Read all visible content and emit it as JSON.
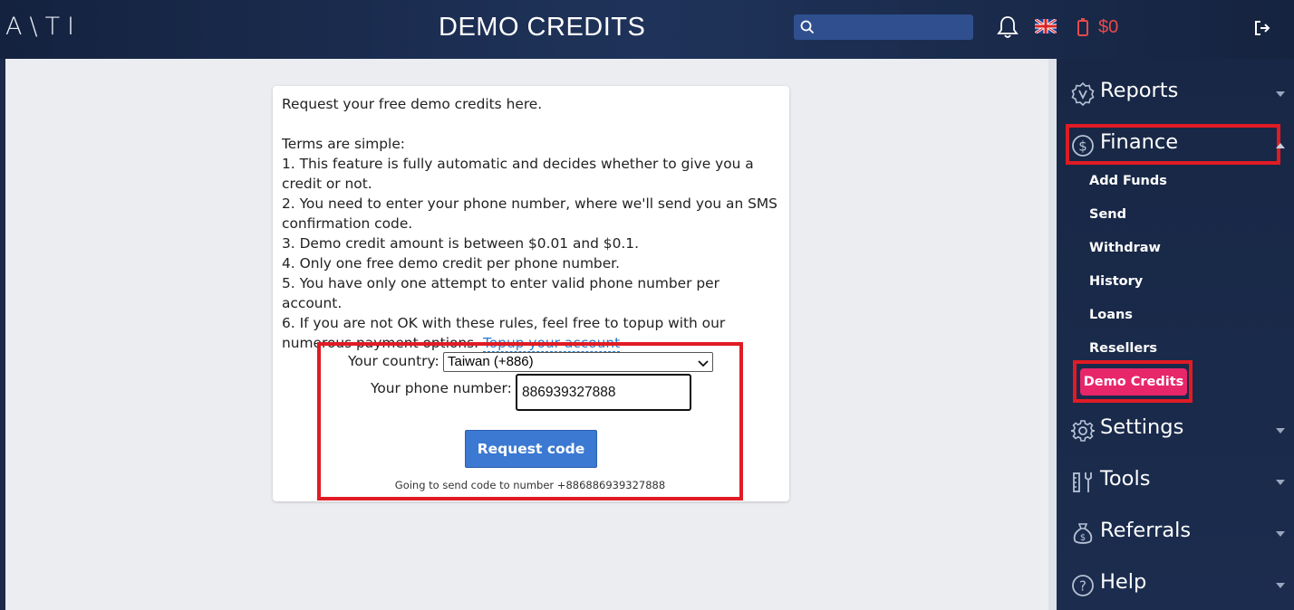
{
  "app": {
    "logo_text": "A\\TI",
    "page_title": "DEMO CREDITS",
    "balance": "$0",
    "search_placeholder": ""
  },
  "card": {
    "intro": "Request your free demo credits here.",
    "terms_heading": "Terms are simple:",
    "terms": [
      "1. This feature is fully automatic and decides whether to give you a credit or not.",
      "2. You need to enter your phone number, where we'll send you an SMS confirmation code.",
      "3. Demo credit amount is between $0.01 and $0.1.",
      "4. Only one free demo credit per phone number.",
      "5. You have only one attempt to enter valid phone number per account.",
      "6. If you are not OK with these rules, feel free to topup with our numerous payment options."
    ],
    "topup_link": "Topup your account"
  },
  "form": {
    "country_label": "Your country:",
    "country_value": "Taiwan (+886)",
    "phone_label": "Your phone number:",
    "phone_value": "886939327888",
    "request_button": "Request code",
    "hint": "Going to send code to number +886886939327888"
  },
  "sidebar": {
    "items": [
      {
        "label": "Reports",
        "icon": "badge-icon",
        "expanded": false
      },
      {
        "label": "Finance",
        "icon": "dollar-icon",
        "expanded": true
      },
      {
        "label": "Settings",
        "icon": "gear-icon",
        "expanded": false
      },
      {
        "label": "Tools",
        "icon": "tools-icon",
        "expanded": false
      },
      {
        "label": "Referrals",
        "icon": "money-bag-icon",
        "expanded": false
      },
      {
        "label": "Help",
        "icon": "question-icon",
        "expanded": false
      }
    ],
    "finance_sub": [
      "Add Funds",
      "Send",
      "Withdraw",
      "History",
      "Loans",
      "Resellers"
    ],
    "active_sub": "Demo Credits"
  },
  "colors": {
    "accent": "#3b79d3",
    "active_pill": "#e8266a",
    "highlight_border": "#e01b24",
    "balance": "#e84a4a"
  }
}
